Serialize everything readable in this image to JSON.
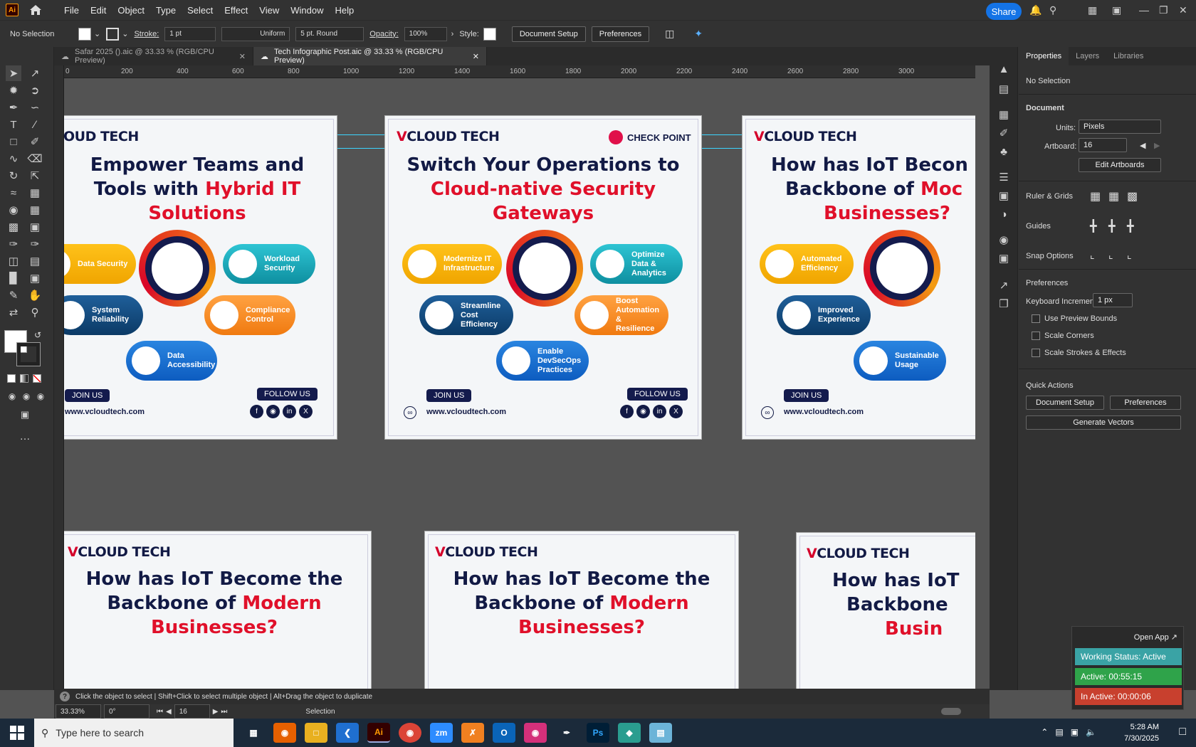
{
  "menubar": {
    "app_logo": "Ai",
    "items": [
      "File",
      "Edit",
      "Object",
      "Type",
      "Select",
      "Effect",
      "View",
      "Window",
      "Help"
    ],
    "share": "Share"
  },
  "control": {
    "selection": "No Selection",
    "stroke_label": "Stroke:",
    "stroke_value": "1 pt",
    "profile": "Uniform",
    "brush": "5 pt. Round",
    "opacity_label": "Opacity:",
    "opacity_value": "100%",
    "style_label": "Style:",
    "doc_setup": "Document Setup",
    "preferences": "Preferences"
  },
  "tabs": [
    {
      "label": "Safar 2025 ().aic @ 33.33 % (RGB/CPU Preview)"
    },
    {
      "label": "Tech Infographic Post.aic @ 33.33 % (RGB/CPU Preview)"
    }
  ],
  "ruler": {
    "h": [
      "0",
      "200",
      "400",
      "600",
      "800",
      "1000",
      "1200",
      "1400",
      "1600",
      "1800",
      "2000",
      "2200",
      "2400",
      "2600",
      "2800",
      "3000"
    ]
  },
  "artboards": {
    "a1": {
      "logo": "OUD TECH",
      "title1": "Empower Teams and",
      "title2": "Tools with ",
      "title2_red": "Hybrid IT",
      "title3_red": "Solutions",
      "pills": [
        "Data Security",
        "Workload Security",
        "System Reliability",
        "Compliance Control",
        "Data Accessibility"
      ],
      "join": "JOIN US",
      "follow": "FOLLOW US",
      "url": "www.vcloudtech.com"
    },
    "a2": {
      "logo_v": "V",
      "logo": "CLOUD TECH",
      "partner": "CHECK POINT",
      "title1": "Switch Your Operations to",
      "title2_red": "Cloud-native Security",
      "title3_red": "Gateways",
      "pills": [
        "Modernize IT Infrastructure",
        "Optimize Data & Analytics",
        "Streamline Cost Efficiency",
        "Boost Automation & Resilience",
        "Enable DevSecOps Practices"
      ],
      "join": "JOIN US",
      "follow": "FOLLOW US",
      "url": "www.vcloudtech.com"
    },
    "a3": {
      "logo_v": "V",
      "logo": "CLOUD TECH",
      "title1": "How has IoT Becon",
      "title2": "Backbone of ",
      "title2_red": "Moc",
      "title3_red": "Businesses?",
      "pills": [
        "Automated Efficiency",
        "Improved Experience",
        "Sustainable Usage"
      ],
      "join": "JOIN US",
      "url": "www.vcloudtech.com"
    },
    "b1": {
      "logo_v": "V",
      "logo": "CLOUD TECH",
      "title1": "How has IoT Become the",
      "title2": "Backbone of ",
      "title2_red": "Modern",
      "title3_red": "Businesses?"
    },
    "b2": {
      "logo_v": "V",
      "logo": "CLOUD TECH",
      "title1": "How has IoT Become the",
      "title2": "Backbone of ",
      "title2_red": "Modern",
      "title3_red": "Businesses?"
    },
    "b3": {
      "logo_v": "V",
      "logo": "CLOUD TECH",
      "title1": "How has IoT",
      "title2": "Backbone",
      "title3_red": "Busin"
    }
  },
  "panel": {
    "tabs": [
      "Properties",
      "Layers",
      "Libraries"
    ],
    "selection": "No Selection",
    "document": "Document",
    "units_label": "Units:",
    "units_value": "Pixels",
    "artboard_label": "Artboard:",
    "artboard_value": "16",
    "edit_artboards": "Edit Artboards",
    "ruler_grids": "Ruler & Grids",
    "guides": "Guides",
    "snap": "Snap Options",
    "preferences": "Preferences",
    "keyboard_inc_label": "Keyboard Increment:",
    "keyboard_inc_value": "1 px",
    "use_preview": "Use Preview Bounds",
    "scale_corners": "Scale Corners",
    "scale_strokes": "Scale Strokes & Effects",
    "quick_actions": "Quick Actions",
    "doc_setup": "Document Setup",
    "prefs_btn": "Preferences",
    "gen_vectors": "Generate Vectors"
  },
  "status": {
    "hint": "Click the object to select  |  Shift+Click to select multiple object  |  Alt+Drag the object to duplicate",
    "zoom": "33.33%",
    "angle": "0°",
    "artboard": "16",
    "tool": "Selection"
  },
  "tracker": {
    "open": "Open App ↗",
    "status": "Working Status: Active",
    "active": "Active: 00:55:15",
    "inactive": "In Active: 00:00:06"
  },
  "taskbar": {
    "search": "Type here to search",
    "time": "5:28 AM",
    "date": "7/30/2025"
  }
}
